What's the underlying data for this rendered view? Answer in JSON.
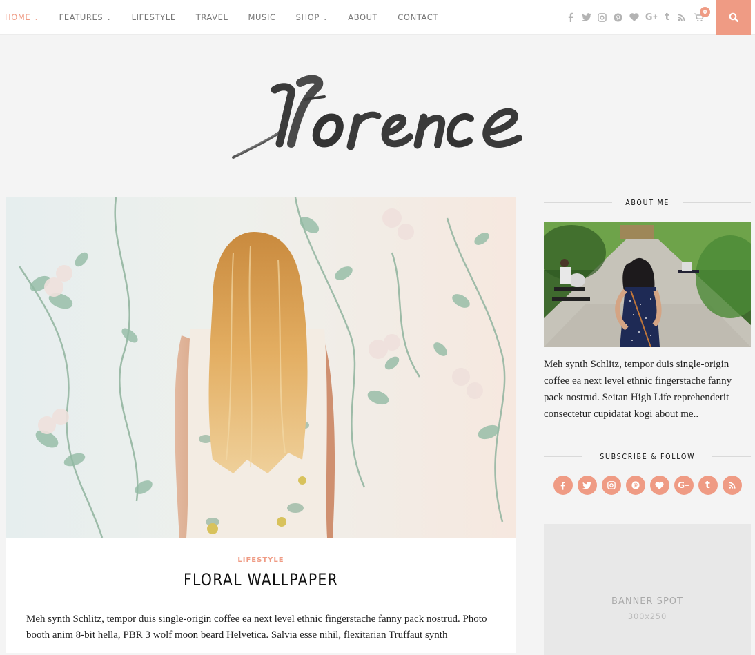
{
  "nav": {
    "items": [
      {
        "label": "HOME",
        "dropdown": true,
        "active": true
      },
      {
        "label": "FEATURES",
        "dropdown": true,
        "active": false
      },
      {
        "label": "LIFESTYLE",
        "dropdown": false,
        "active": false
      },
      {
        "label": "TRAVEL",
        "dropdown": false,
        "active": false
      },
      {
        "label": "MUSIC",
        "dropdown": false,
        "active": false
      },
      {
        "label": "SHOP",
        "dropdown": true,
        "active": false
      },
      {
        "label": "ABOUT",
        "dropdown": false,
        "active": false
      },
      {
        "label": "CONTACT",
        "dropdown": false,
        "active": false
      }
    ],
    "social_icons": [
      "facebook-icon",
      "twitter-icon",
      "instagram-icon",
      "pinterest-icon",
      "bloglovin-heart-icon",
      "google-plus-icon",
      "tumblr-icon",
      "rss-icon"
    ],
    "cart_count": "0",
    "search_icon": "search-icon"
  },
  "logo": {
    "text": "florence"
  },
  "post": {
    "category": "LIFESTYLE",
    "title": "FLORAL WALLPAPER",
    "excerpt": "Meh synth Schlitz, tempor duis single-origin coffee ea next level ethnic fingerstache fanny pack nostrud. Photo booth anim 8-bit hella, PBR 3 wolf moon beard Helvetica. Salvia esse nihil, flexitarian Truffaut synth",
    "image_alt": "Woman with long blonde hair facing floral wallpaper"
  },
  "sidebar": {
    "about": {
      "title": "ABOUT ME",
      "image_alt": "Woman in polka dot dress on park path",
      "text": "Meh synth Schlitz, tempor duis single-origin coffee ea next level ethnic fingerstache fanny pack nostrud. Seitan High Life reprehenderit consectetur cupidatat kogi about me.."
    },
    "subscribe": {
      "title": "SUBSCRIBE & FOLLOW",
      "icons": [
        "facebook-icon",
        "twitter-icon",
        "instagram-icon",
        "pinterest-icon",
        "bloglovin-heart-icon",
        "google-plus-icon",
        "tumblr-icon",
        "rss-icon"
      ]
    },
    "banner": {
      "title": "BANNER SPOT",
      "size": "300x250"
    }
  },
  "colors": {
    "accent": "#ef9b84",
    "background": "#f4f4f4",
    "banner": "#e8e8e8"
  }
}
